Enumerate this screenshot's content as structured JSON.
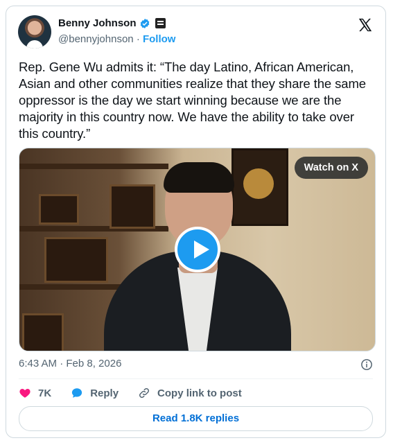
{
  "author": {
    "name": "Benny Johnson",
    "handle": "@bennyjohnson",
    "separator": "·",
    "follow_label": "Follow"
  },
  "tweet": {
    "text": "Rep. Gene Wu admits it: “The day Latino, African American, Asian and other communities realize that they share the same oppressor is the day we start winning because we are the majority in this country now. We have the ability to take over this country.”"
  },
  "media": {
    "watch_label": "Watch on X"
  },
  "timestamp": "6:43 AM · Feb 8, 2026",
  "actions": {
    "likes_count": "7K",
    "reply_label": "Reply",
    "copy_label": "Copy link to post"
  },
  "read_replies_label": "Read 1.8K replies",
  "icons": {
    "verified": "verified-badge-icon",
    "affiliate": "news-affiliate-icon",
    "logo": "x-logo-icon",
    "info": "info-icon",
    "like": "heart-icon",
    "reply": "reply-bubble-icon",
    "copy": "link-icon"
  },
  "colors": {
    "accent": "#1d9bf0",
    "heart": "#f91880",
    "muted": "#536471",
    "text": "#0f1419",
    "link": "#006fd6"
  }
}
